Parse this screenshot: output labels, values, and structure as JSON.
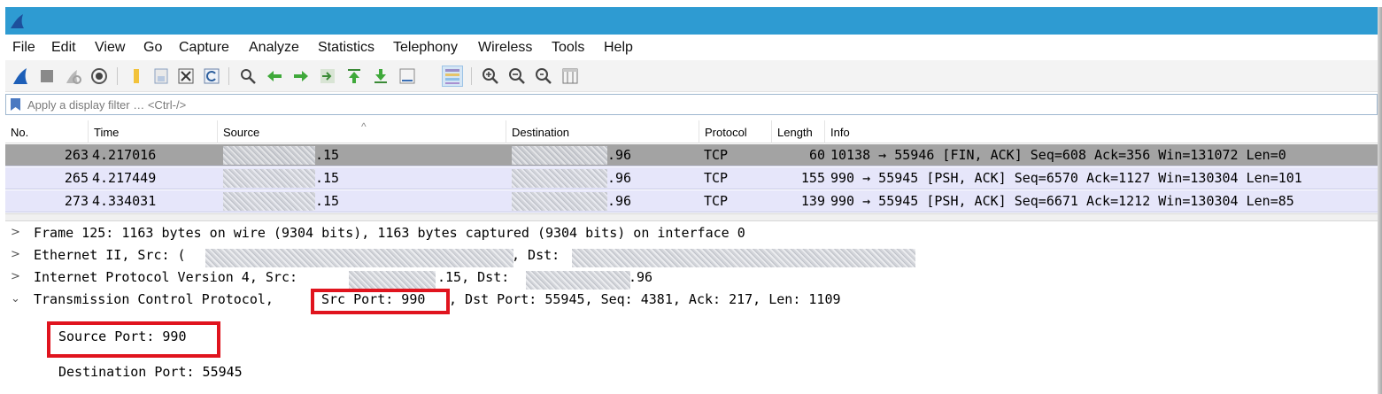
{
  "app": {
    "icon": "wireshark-fin-icon",
    "titlebar_color": "#2e9bd2"
  },
  "menu": [
    "File",
    "Edit",
    "View",
    "Go",
    "Capture",
    "Analyze",
    "Statistics",
    "Telephony",
    "Wireless",
    "Tools",
    "Help"
  ],
  "toolbar": {
    "icons": [
      "start-capture-icon",
      "stop-capture-icon",
      "restart-capture-icon",
      "capture-options-icon",
      "open-file-icon",
      "save-file-icon",
      "close-file-icon",
      "reload-file-icon",
      "find-packet-icon",
      "go-back-icon",
      "go-forward-icon",
      "go-to-packet-icon",
      "go-first-icon",
      "go-last-icon",
      "auto-scroll-icon",
      "colorize-icon",
      "zoom-in-icon",
      "zoom-out-icon",
      "zoom-normal-icon",
      "resize-columns-icon"
    ]
  },
  "filter": {
    "placeholder": "Apply a display filter … <Ctrl-/>"
  },
  "packet_list": {
    "columns": [
      "No.",
      "Time",
      "Source",
      "Destination",
      "Protocol",
      "Length",
      "Info"
    ],
    "rows": [
      {
        "no": "263",
        "time": "4.217016",
        "src_suffix": ".15",
        "dst_suffix": ".96",
        "protocol": "TCP",
        "length": "60",
        "info": "10138 → 55946 [FIN, ACK] Seq=608 Ack=356 Win=131072 Len=0",
        "selected": true
      },
      {
        "no": "265",
        "time": "4.217449",
        "src_suffix": ".15",
        "dst_suffix": ".96",
        "protocol": "TCP",
        "length": "155",
        "info": "990 → 55945 [PSH, ACK] Seq=6570 Ack=1127 Win=130304 Len=101",
        "selected": false
      },
      {
        "no": "273",
        "time": "4.334031",
        "src_suffix": ".15",
        "dst_suffix": ".96",
        "protocol": "TCP",
        "length": "139",
        "info": "990 → 55945 [PSH, ACK] Seq=6671 Ack=1212 Win=130304 Len=85",
        "selected": false
      }
    ]
  },
  "details": {
    "frame": "Frame 125: 1163 bytes on wire (9304 bits), 1163 bytes captured (9304 bits) on interface 0",
    "ethernet_prefix": "Ethernet II, Src: (",
    "ethernet_dst": ", Dst: ",
    "ip_prefix": "Internet Protocol Version 4, Src: ",
    "ip_src_suffix": ".15, Dst: ",
    "ip_dst_suffix": ".96",
    "tcp_prefix": "Transmission Control Protocol, ",
    "tcp_src_port": "Src Port: 990",
    "tcp_rest": ", Dst Port: 55945, Seq: 4381, Ack: 217, Len: 1109",
    "source_port": "Source Port: 990",
    "destination_port": "Destination Port: 55945"
  },
  "colors": {
    "selected_row": "#a3a3a3",
    "tcp_row": "#e6e6fa",
    "highlight": "#e0141e"
  }
}
